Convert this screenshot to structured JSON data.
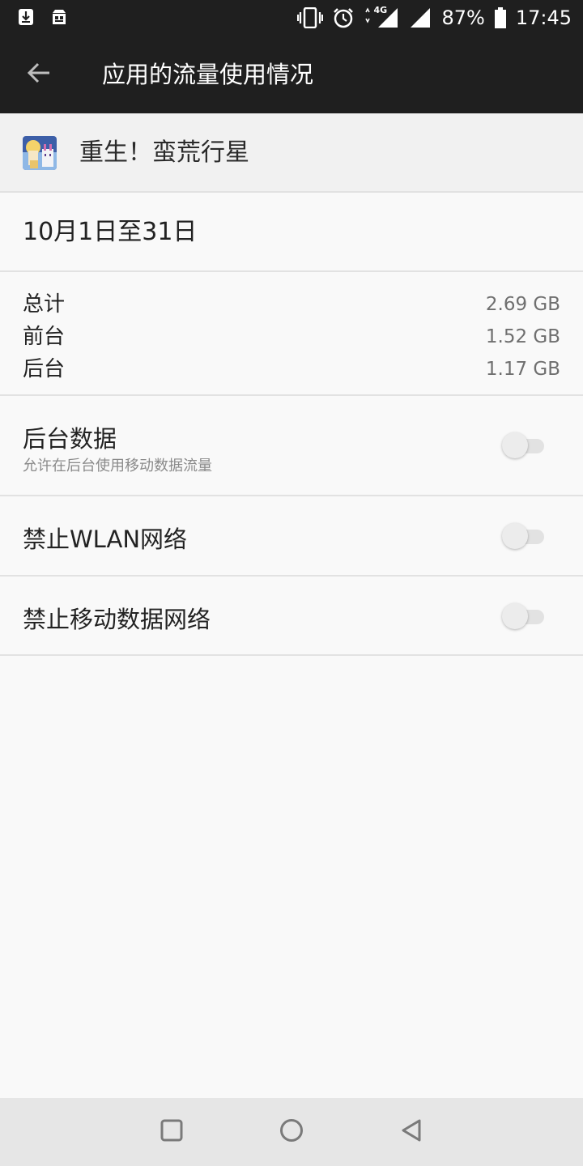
{
  "status_bar": {
    "battery": "87%",
    "time": "17:45",
    "network": "4G"
  },
  "header": {
    "title": "应用的流量使用情况"
  },
  "app": {
    "name": "重生！蛮荒行星"
  },
  "period": {
    "label": "10月1日至31日"
  },
  "usage": [
    {
      "label": "总计",
      "value": "2.69 GB"
    },
    {
      "label": "前台",
      "value": "1.52 GB"
    },
    {
      "label": "后台",
      "value": "1.17 GB"
    }
  ],
  "settings": {
    "background_data": {
      "title": "后台数据",
      "subtitle": "允许在后台使用移动数据流量",
      "enabled": false
    },
    "block_wlan": {
      "title": "禁止WLAN网络",
      "enabled": false
    },
    "block_mobile": {
      "title": "禁止移动数据网络",
      "enabled": false
    }
  },
  "colors": {
    "app_bar": "#1f1f1f",
    "background": "#f9f9f9",
    "divider": "#e2e2e2",
    "secondary_text": "#6f6f6f"
  }
}
